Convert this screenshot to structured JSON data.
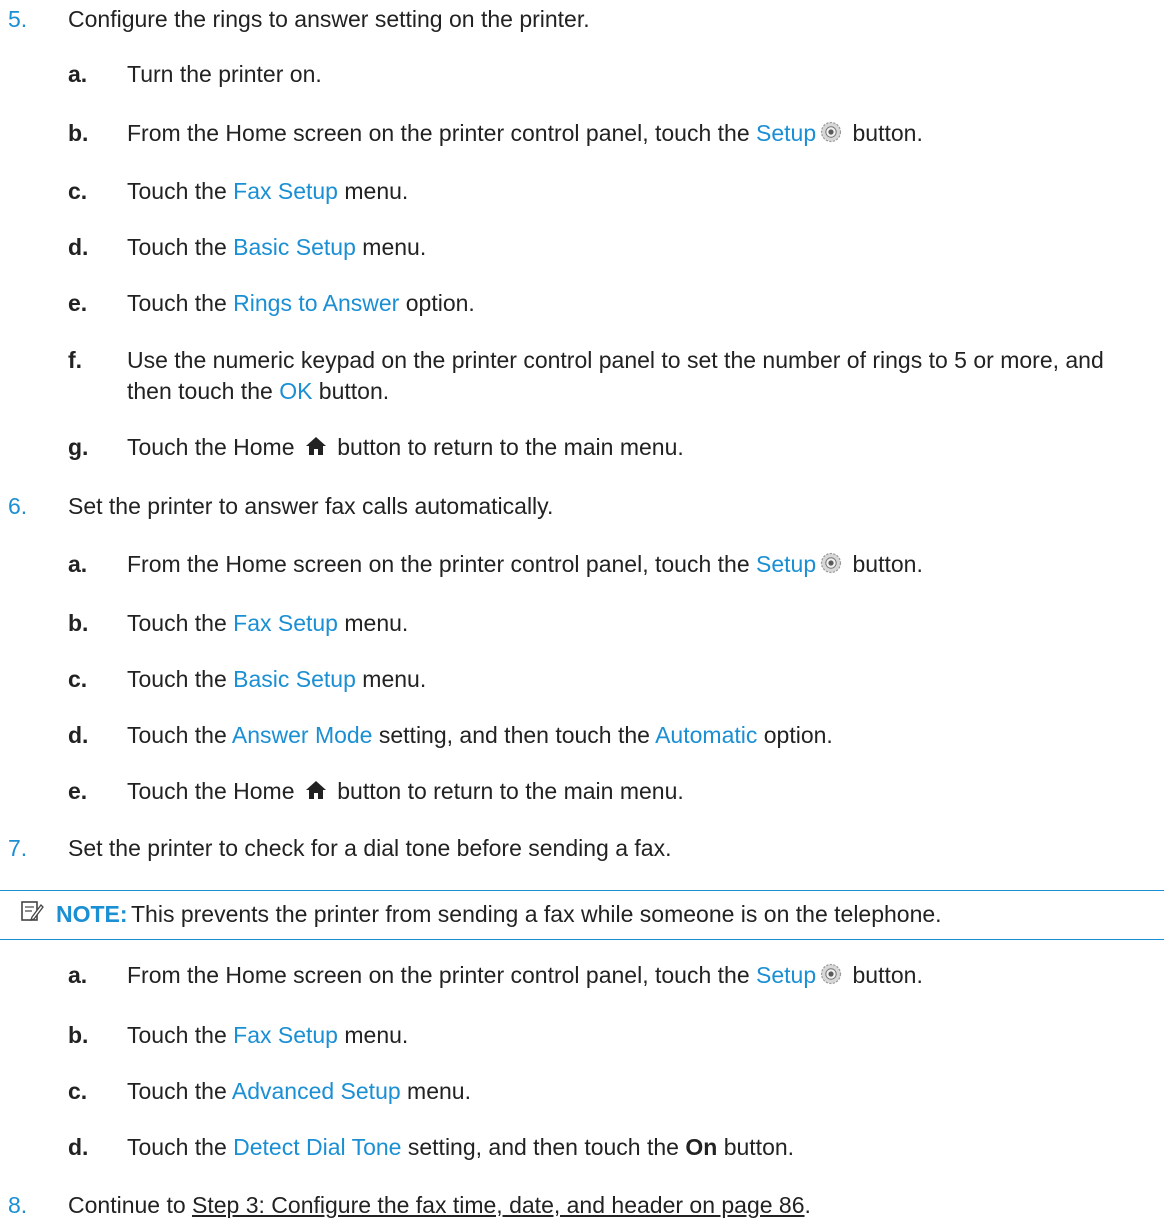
{
  "colors": {
    "accent": "#1a8fd4",
    "text": "#222222"
  },
  "steps": [
    {
      "number": "5.",
      "text": "Configure the rings to answer setting on the printer.",
      "substeps": [
        {
          "letter": "a.",
          "parts": [
            "Turn the printer on."
          ]
        },
        {
          "letter": "b.",
          "parts": [
            "From the Home screen on the printer control panel, touch the ",
            "Setup",
            " button."
          ],
          "icon": "gear-icon"
        },
        {
          "letter": "c.",
          "parts": [
            "Touch the ",
            "Fax Setup",
            " menu."
          ]
        },
        {
          "letter": "d.",
          "parts": [
            "Touch the ",
            "Basic Setup",
            " menu."
          ]
        },
        {
          "letter": "e.",
          "parts": [
            "Touch the ",
            "Rings to Answer",
            " option."
          ]
        },
        {
          "letter": "f.",
          "parts": [
            "Use the numeric keypad on the printer control panel to set the number of rings to 5 or more, and",
            "then touch the ",
            "OK",
            " button."
          ]
        },
        {
          "letter": "g.",
          "parts": [
            "Touch the Home ",
            " button to return to the main menu."
          ],
          "icon": "home-icon"
        }
      ]
    },
    {
      "number": "6.",
      "text": "Set the printer to answer fax calls automatically.",
      "substeps": [
        {
          "letter": "a.",
          "parts": [
            "From the Home screen on the printer control panel, touch the ",
            "Setup",
            " button."
          ],
          "icon": "gear-icon"
        },
        {
          "letter": "b.",
          "parts": [
            "Touch the ",
            "Fax Setup",
            " menu."
          ]
        },
        {
          "letter": "c.",
          "parts": [
            "Touch the ",
            "Basic Setup",
            " menu."
          ]
        },
        {
          "letter": "d.",
          "parts": [
            "Touch the ",
            "Answer Mode",
            " setting, and then touch the ",
            "Automatic",
            " option."
          ]
        },
        {
          "letter": "e.",
          "parts": [
            "Touch the Home ",
            " button to return to the main menu."
          ],
          "icon": "home-icon"
        }
      ]
    },
    {
      "number": "7.",
      "text": "Set the printer to check for a dial tone before sending a fax.",
      "note": {
        "label": "NOTE:",
        "text": "This prevents the printer from sending a fax while someone is on the telephone.",
        "icon": "note-icon"
      },
      "substeps": [
        {
          "letter": "a.",
          "parts": [
            "From the Home screen on the printer control panel, touch the ",
            "Setup",
            " button."
          ],
          "icon": "gear-icon"
        },
        {
          "letter": "b.",
          "parts": [
            "Touch the ",
            "Fax Setup",
            " menu."
          ]
        },
        {
          "letter": "c.",
          "parts": [
            "Touch the ",
            "Advanced Setup",
            " menu."
          ]
        },
        {
          "letter": "d.",
          "parts": [
            "Touch the ",
            "Detect Dial Tone",
            " setting, and then touch the ",
            "On",
            " button."
          ]
        }
      ]
    },
    {
      "number": "8.",
      "parts": [
        "Continue to ",
        "Step 3: Configure the fax time, date, and header on page 86",
        "."
      ]
    }
  ]
}
